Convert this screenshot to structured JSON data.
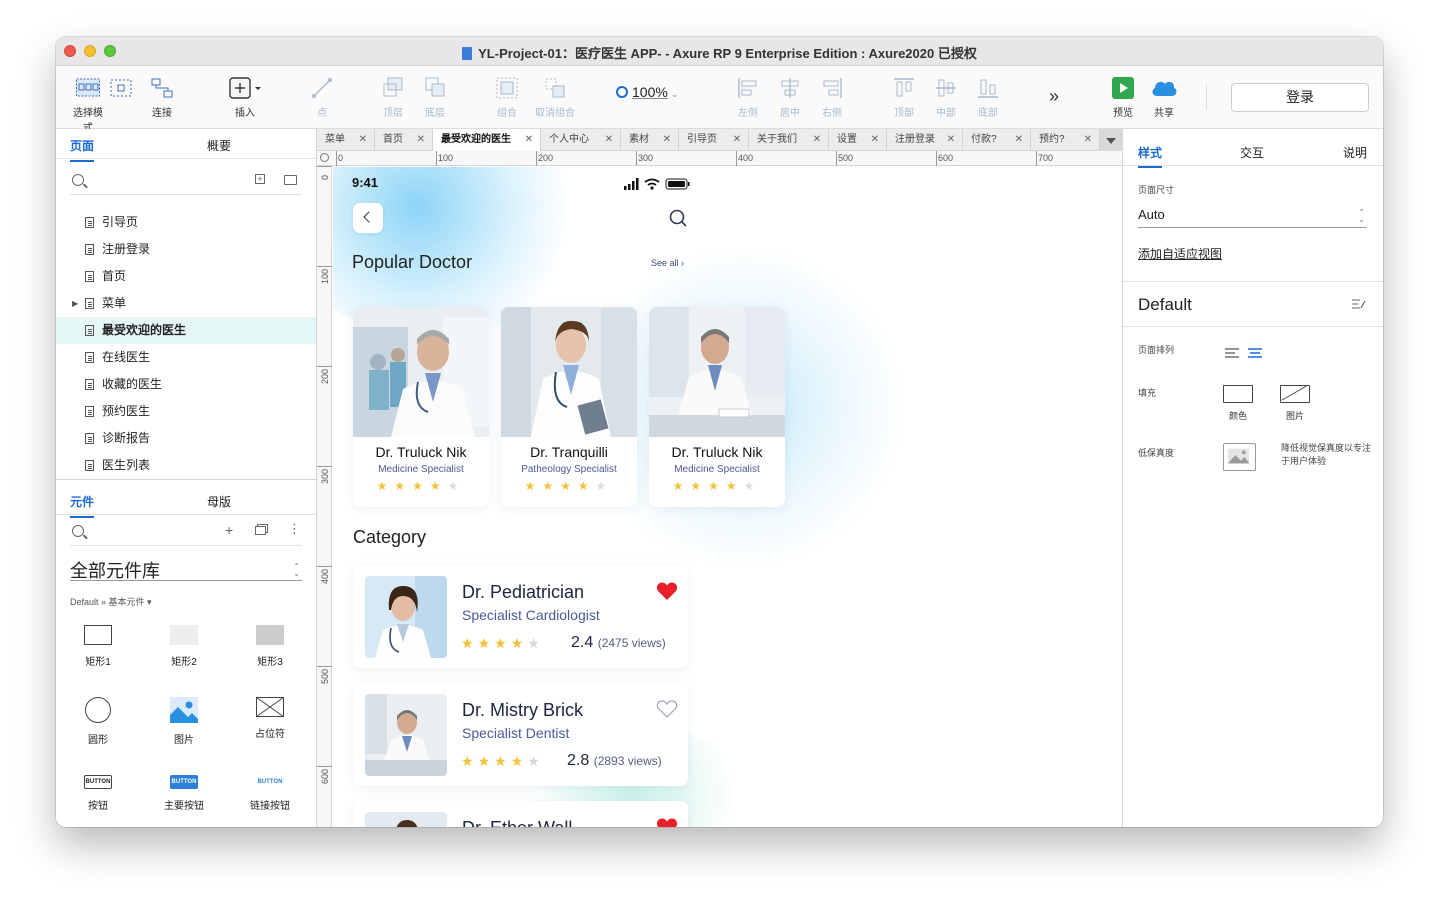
{
  "window": {
    "title": "YL-Project-01：医疗医生 APP- - Axure RP 9 Enterprise Edition : Axure2020 已授权"
  },
  "toolbar": {
    "select_mode": "选择模式",
    "connect": "连接",
    "insert": "插入",
    "point": "点",
    "top_layer": "顶层",
    "bottom_layer": "底层",
    "group": "组合",
    "ungroup": "取消组合",
    "zoom": "100%",
    "align_left": "左侧",
    "align_center": "居中",
    "align_right": "右侧",
    "align_top": "顶部",
    "align_middle": "中部",
    "align_bottom": "底部",
    "preview": "预览",
    "share": "共享",
    "login": "登录"
  },
  "left_panel": {
    "tabs": [
      "页面",
      "概要"
    ],
    "pages": [
      {
        "label": "引导页",
        "active": false,
        "expandable": false
      },
      {
        "label": "注册登录",
        "active": false,
        "expandable": false
      },
      {
        "label": "首页",
        "active": false,
        "expandable": false
      },
      {
        "label": "菜单",
        "active": false,
        "expandable": true
      },
      {
        "label": "最受欢迎的医生",
        "active": true,
        "expandable": false
      },
      {
        "label": "在线医生",
        "active": false,
        "expandable": false
      },
      {
        "label": "收藏的医生",
        "active": false,
        "expandable": false
      },
      {
        "label": "预约医生",
        "active": false,
        "expandable": false
      },
      {
        "label": "诊断报告",
        "active": false,
        "expandable": false
      },
      {
        "label": "医生列表",
        "active": false,
        "expandable": false
      }
    ],
    "lib_tabs": [
      "元件",
      "母版"
    ],
    "library_title": "全部元件库",
    "library_sub": "Default » 基本元件",
    "widgets": [
      "矩形1",
      "矩形2",
      "矩形3",
      "圆形",
      "图片",
      "占位符",
      "按钮",
      "主要按钮",
      "链接按钮"
    ],
    "button_text": "BUTTON"
  },
  "canvas": {
    "tabs": [
      {
        "label": "菜单",
        "active": false
      },
      {
        "label": "首页",
        "active": false
      },
      {
        "label": "最受欢迎的医生",
        "active": true
      },
      {
        "label": "个人中心",
        "active": false
      },
      {
        "label": "素材",
        "active": false
      },
      {
        "label": "引导页",
        "active": false
      },
      {
        "label": "关于我们",
        "active": false
      },
      {
        "label": "设置",
        "active": false
      },
      {
        "label": "注册登录",
        "active": false
      },
      {
        "label": "付款?",
        "active": false
      },
      {
        "label": "预约?",
        "active": false
      }
    ],
    "ruler_h": [
      "0",
      "100",
      "200",
      "300",
      "400",
      "500",
      "600",
      "700"
    ],
    "ruler_v": [
      "0",
      "100",
      "200",
      "300",
      "400",
      "500",
      "600"
    ]
  },
  "mobile": {
    "time": "9:41",
    "popular_title": "Popular Doctor",
    "see_all": "See all ›",
    "popular": [
      {
        "name": "Dr. Truluck Nik",
        "specialty": "Medicine Specialist",
        "rating": 4
      },
      {
        "name": "Dr. Tranquilli",
        "specialty": "Patheology Specialist",
        "rating": 4
      },
      {
        "name": "Dr. Truluck Nik",
        "specialty": "Medicine Specialist",
        "rating": 4
      }
    ],
    "category_title": "Category",
    "category": [
      {
        "name": "Dr. Pediatrician",
        "specialty": "Specialist Cardiologist",
        "rating": "2.4",
        "views": "(2475 views)",
        "stars": 4,
        "favorite": true
      },
      {
        "name": "Dr. Mistry Brick",
        "specialty": "Specialist Dentist",
        "rating": "2.8",
        "views": "(2893 views)",
        "stars": 4,
        "favorite": false
      },
      {
        "name": "Dr. Ether Wall",
        "favorite": true
      }
    ]
  },
  "right_panel": {
    "tabs": [
      "样式",
      "交互",
      "说明"
    ],
    "page_size_label": "页面尺寸",
    "page_size_value": "Auto",
    "add_adaptive": "添加自适应视图",
    "default_label": "Default",
    "arrange_label": "页面排列",
    "fill_label": "填充",
    "fill_color": "颜色",
    "fill_image": "图片",
    "low_fidelity_label": "低保真度",
    "low_fidelity_desc_1": "降低视觉保真度以专注",
    "low_fidelity_desc_2": "于用户体验"
  },
  "colors": {
    "accent": "#1d6ad6",
    "star": "#f4c13a",
    "heart": "#e8202a",
    "selected_row": "#e5f6f7"
  }
}
